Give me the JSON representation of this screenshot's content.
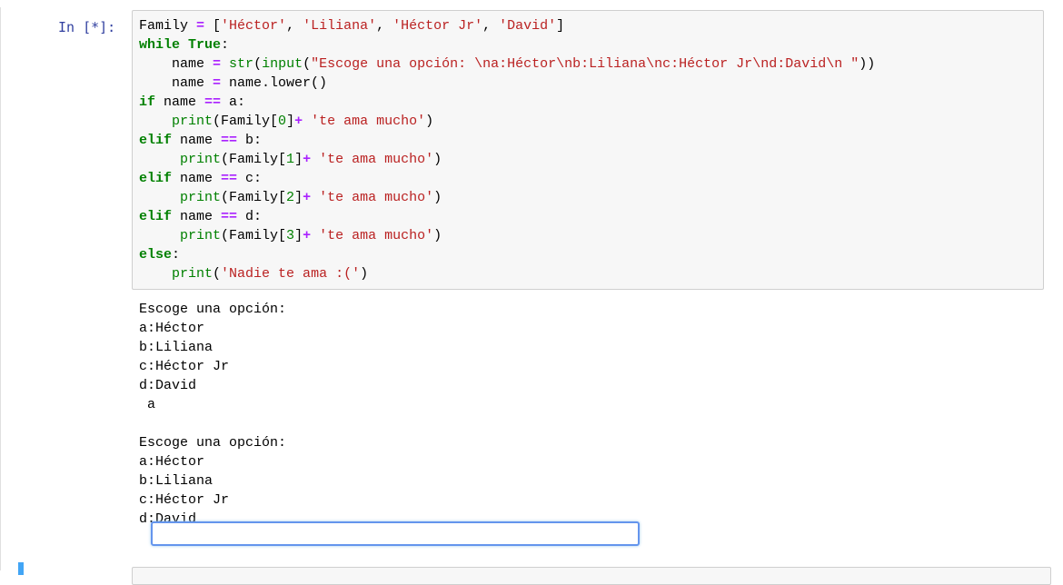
{
  "cell": {
    "prompt": "In [*]:",
    "code_lines": [
      [
        {
          "t": "Family "
        },
        {
          "t": "=",
          "c": "op"
        },
        {
          "t": " ["
        },
        {
          "t": "'Héctor'",
          "c": "str"
        },
        {
          "t": ", "
        },
        {
          "t": "'Liliana'",
          "c": "str"
        },
        {
          "t": ", "
        },
        {
          "t": "'Héctor Jr'",
          "c": "str"
        },
        {
          "t": ", "
        },
        {
          "t": "'David'",
          "c": "str"
        },
        {
          "t": "]"
        }
      ],
      [
        {
          "t": "while",
          "c": "kw"
        },
        {
          "t": " "
        },
        {
          "t": "True",
          "c": "kw"
        },
        {
          "t": ":"
        }
      ],
      [
        {
          "t": "    name "
        },
        {
          "t": "=",
          "c": "op"
        },
        {
          "t": " "
        },
        {
          "t": "str",
          "c": "bi"
        },
        {
          "t": "("
        },
        {
          "t": "input",
          "c": "bi"
        },
        {
          "t": "("
        },
        {
          "t": "\"Escoge una opción: \\na:Héctor\\nb:Liliana\\nc:Héctor Jr\\nd:David\\n \"",
          "c": "str"
        },
        {
          "t": "))"
        }
      ],
      [
        {
          "t": "    name "
        },
        {
          "t": "=",
          "c": "op"
        },
        {
          "t": " name.lower()"
        }
      ],
      [
        {
          "t": "if",
          "c": "kw"
        },
        {
          "t": " name "
        },
        {
          "t": "==",
          "c": "op"
        },
        {
          "t": " a:"
        }
      ],
      [
        {
          "t": "    "
        },
        {
          "t": "print",
          "c": "bi"
        },
        {
          "t": "(Family["
        },
        {
          "t": "0",
          "c": "num"
        },
        {
          "t": "]"
        },
        {
          "t": "+",
          "c": "op"
        },
        {
          "t": " "
        },
        {
          "t": "'te ama mucho'",
          "c": "str"
        },
        {
          "t": ")"
        }
      ],
      [
        {
          "t": "elif",
          "c": "kw"
        },
        {
          "t": " name "
        },
        {
          "t": "==",
          "c": "op"
        },
        {
          "t": " b:"
        }
      ],
      [
        {
          "t": "     "
        },
        {
          "t": "print",
          "c": "bi"
        },
        {
          "t": "(Family["
        },
        {
          "t": "1",
          "c": "num"
        },
        {
          "t": "]"
        },
        {
          "t": "+",
          "c": "op"
        },
        {
          "t": " "
        },
        {
          "t": "'te ama mucho'",
          "c": "str"
        },
        {
          "t": ")"
        }
      ],
      [
        {
          "t": "elif",
          "c": "kw"
        },
        {
          "t": " name "
        },
        {
          "t": "==",
          "c": "op"
        },
        {
          "t": " c:"
        }
      ],
      [
        {
          "t": "     "
        },
        {
          "t": "print",
          "c": "bi"
        },
        {
          "t": "(Family["
        },
        {
          "t": "2",
          "c": "num"
        },
        {
          "t": "]"
        },
        {
          "t": "+",
          "c": "op"
        },
        {
          "t": " "
        },
        {
          "t": "'te ama mucho'",
          "c": "str"
        },
        {
          "t": ")"
        }
      ],
      [
        {
          "t": "elif",
          "c": "kw"
        },
        {
          "t": " name "
        },
        {
          "t": "==",
          "c": "op"
        },
        {
          "t": " d:"
        }
      ],
      [
        {
          "t": "     "
        },
        {
          "t": "print",
          "c": "bi"
        },
        {
          "t": "(Family["
        },
        {
          "t": "3",
          "c": "num"
        },
        {
          "t": "]"
        },
        {
          "t": "+",
          "c": "op"
        },
        {
          "t": " "
        },
        {
          "t": "'te ama mucho'",
          "c": "str"
        },
        {
          "t": ")"
        }
      ],
      [
        {
          "t": "else",
          "c": "kw"
        },
        {
          "t": ":"
        }
      ],
      [
        {
          "t": "    "
        },
        {
          "t": "print",
          "c": "bi"
        },
        {
          "t": "("
        },
        {
          "t": "'Nadie te ama :('",
          "c": "str"
        },
        {
          "t": ")"
        }
      ]
    ],
    "output_text": "Escoge una opción: \na:Héctor\nb:Liliana\nc:Héctor Jr\nd:David\n a\n\nEscoge una opción: \na:Héctor\nb:Liliana\nc:Héctor Jr\nd:David",
    "input_value": ""
  },
  "colors": {
    "keyword": "#008000",
    "operator": "#aa22ff",
    "string": "#ba2121",
    "prompt": "#303f9f",
    "input_focus": "#6495ed"
  }
}
